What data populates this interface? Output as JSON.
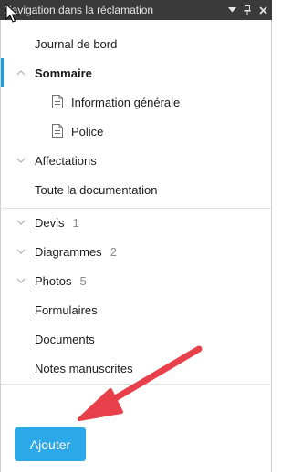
{
  "panel": {
    "title": "Navigation dans la réclamation",
    "controls": [
      "chevron-down-icon",
      "pin-icon",
      "close-icon"
    ]
  },
  "nav": {
    "journal": "Journal de bord",
    "sommaire": "Sommaire",
    "info_generale": "Information générale",
    "police": "Police",
    "affectations": "Affectations",
    "toute_doc": "Toute la documentation",
    "devis": {
      "label": "Devis",
      "count": "1"
    },
    "diagrammes": {
      "label": "Diagrammes",
      "count": "2"
    },
    "photos": {
      "label": "Photos",
      "count": "5"
    },
    "formulaires": "Formulaires",
    "documents": "Documents",
    "notes": "Notes manuscrites"
  },
  "actions": {
    "add_label": "Ajouter"
  },
  "colors": {
    "accent": "#1ba1e2",
    "button": "#2aa8e8",
    "annotation_arrow": "#e8404a",
    "titlebar": "#3a3a3a"
  }
}
